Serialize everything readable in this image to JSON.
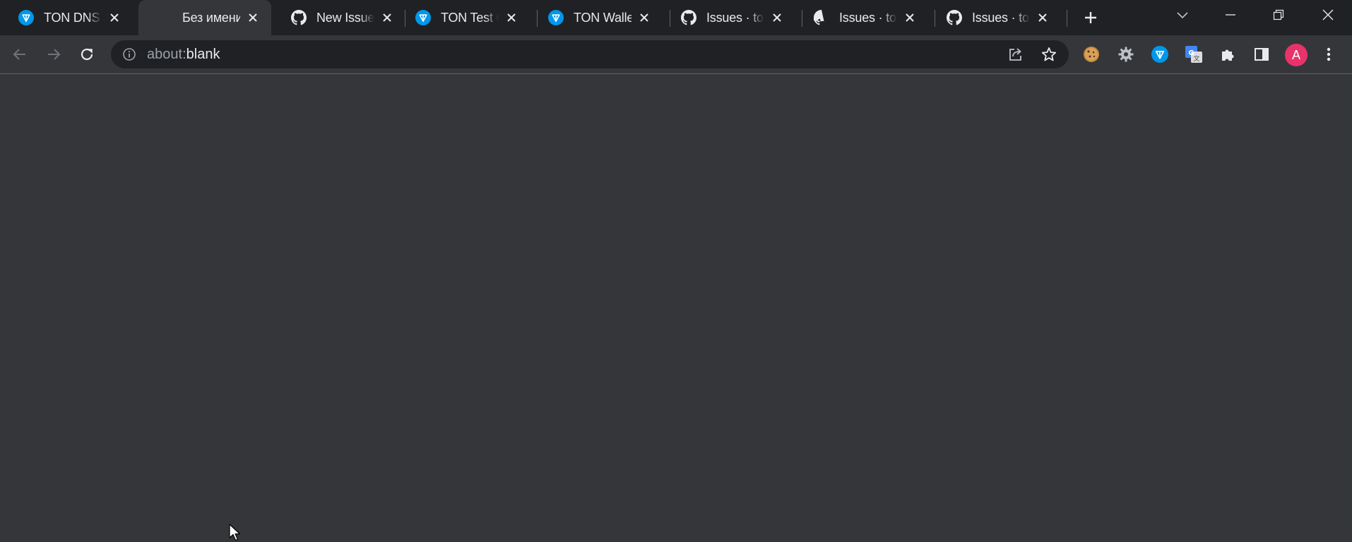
{
  "tabs": [
    {
      "title": "TON DNS",
      "icon": "ton-icon",
      "active": false
    },
    {
      "title": "Без имени",
      "icon": "",
      "active": true
    },
    {
      "title": "New Issue · t",
      "icon": "github-icon",
      "active": false
    },
    {
      "title": "TON Test Cli",
      "icon": "ton-icon",
      "active": false
    },
    {
      "title": "TON Wallet",
      "icon": "ton-icon",
      "active": false
    },
    {
      "title": "Issues · tonk",
      "icon": "github-icon",
      "active": false
    },
    {
      "title": "Issues · tonk",
      "icon": "github-icon",
      "active": false
    },
    {
      "title": "Issues · tonk",
      "icon": "github-icon",
      "active": false
    }
  ],
  "omnibox": {
    "scheme": "about",
    "separator": ":",
    "path": "blank"
  },
  "profile": {
    "initial": "A",
    "color": "#e8336a"
  },
  "colors": {
    "tabstrip": "#202124",
    "toolbar": "#35363a",
    "omnibox": "#202124",
    "ton_blue": "#0098ea"
  }
}
